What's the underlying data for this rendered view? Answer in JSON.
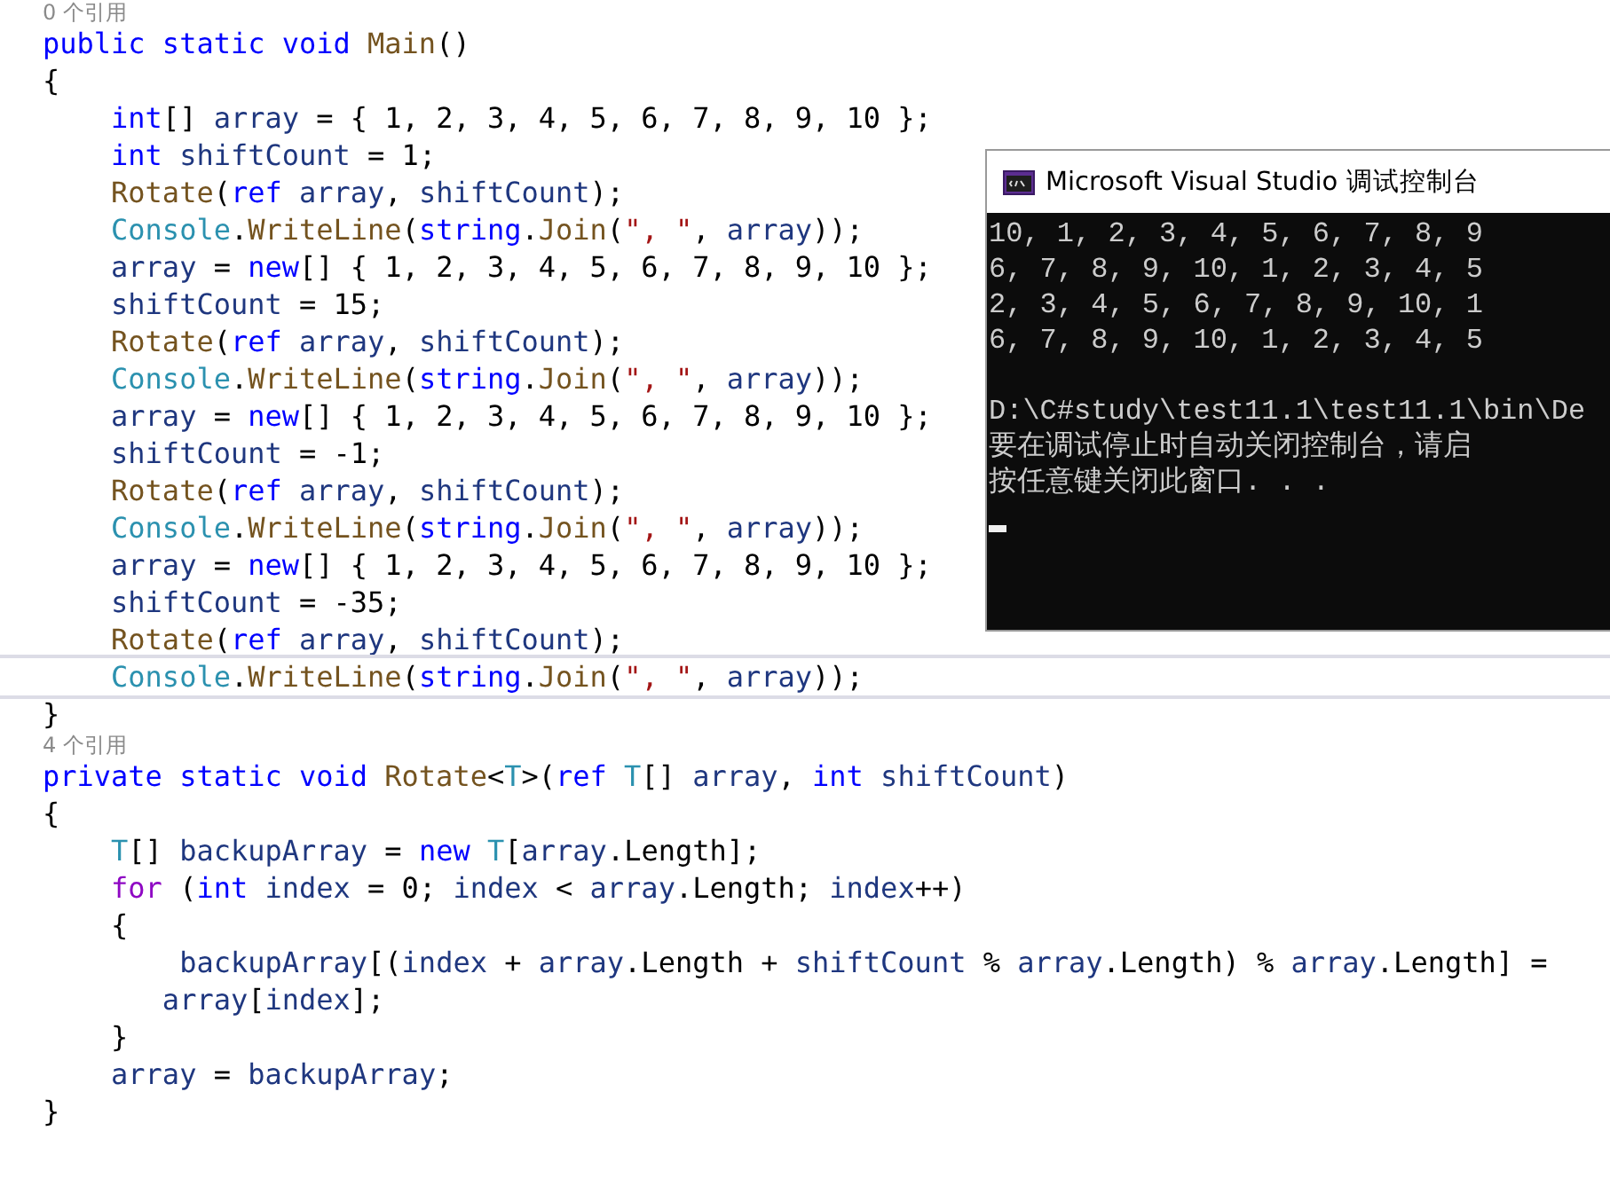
{
  "editor": {
    "lines": [
      {
        "kind": "codelens",
        "text": "0 个引用"
      },
      {
        "kind": "code",
        "current": false,
        "tokens": [
          {
            "text": "public static void ",
            "kind": "kw"
          },
          {
            "text": "Main",
            "kind": "method"
          },
          {
            "text": "()",
            "kind": "plain"
          }
        ]
      },
      {
        "kind": "code",
        "current": false,
        "tokens": [
          {
            "text": "{",
            "kind": "plain"
          }
        ]
      },
      {
        "kind": "code",
        "current": false,
        "tokens": [
          {
            "text": "    int",
            "kind": "kw"
          },
          {
            "text": "[] ",
            "kind": "plain"
          },
          {
            "text": "array",
            "kind": "local"
          },
          {
            "text": " = { 1, 2, 3, 4, 5, 6, 7, 8, 9, 10 };",
            "kind": "plain"
          }
        ]
      },
      {
        "kind": "code",
        "current": false,
        "tokens": [
          {
            "text": "    int",
            "kind": "kw"
          },
          {
            "text": " shiftCount",
            "kind": "local"
          },
          {
            "text": " = 1;",
            "kind": "plain"
          }
        ]
      },
      {
        "kind": "code",
        "current": false,
        "tokens": [
          {
            "text": "    Rotate",
            "kind": "method"
          },
          {
            "text": "(",
            "kind": "plain"
          },
          {
            "text": "ref",
            "kind": "kw"
          },
          {
            "text": " array",
            "kind": "local"
          },
          {
            "text": ", ",
            "kind": "plain"
          },
          {
            "text": "shiftCount",
            "kind": "local"
          },
          {
            "text": ");",
            "kind": "plain"
          }
        ]
      },
      {
        "kind": "code",
        "current": false,
        "tokens": [
          {
            "text": "    Console",
            "kind": "type"
          },
          {
            "text": ".",
            "kind": "plain"
          },
          {
            "text": "WriteLine",
            "kind": "method"
          },
          {
            "text": "(",
            "kind": "plain"
          },
          {
            "text": "string",
            "kind": "kw"
          },
          {
            "text": ".",
            "kind": "plain"
          },
          {
            "text": "Join",
            "kind": "method"
          },
          {
            "text": "(",
            "kind": "plain"
          },
          {
            "text": "\", \"",
            "kind": "str"
          },
          {
            "text": ", ",
            "kind": "plain"
          },
          {
            "text": "array",
            "kind": "local"
          },
          {
            "text": "));",
            "kind": "plain"
          }
        ]
      },
      {
        "kind": "code",
        "current": false,
        "tokens": [
          {
            "text": "    array",
            "kind": "local"
          },
          {
            "text": " = ",
            "kind": "plain"
          },
          {
            "text": "new",
            "kind": "kw"
          },
          {
            "text": "[] { 1, 2, 3, 4, 5, 6, 7, 8, 9, 10 };",
            "kind": "plain"
          }
        ]
      },
      {
        "kind": "code",
        "current": false,
        "tokens": [
          {
            "text": "    shiftCount",
            "kind": "local"
          },
          {
            "text": " = 15;",
            "kind": "plain"
          }
        ]
      },
      {
        "kind": "code",
        "current": false,
        "tokens": [
          {
            "text": "    Rotate",
            "kind": "method"
          },
          {
            "text": "(",
            "kind": "plain"
          },
          {
            "text": "ref",
            "kind": "kw"
          },
          {
            "text": " array",
            "kind": "local"
          },
          {
            "text": ", ",
            "kind": "plain"
          },
          {
            "text": "shiftCount",
            "kind": "local"
          },
          {
            "text": ");",
            "kind": "plain"
          }
        ]
      },
      {
        "kind": "code",
        "current": false,
        "tokens": [
          {
            "text": "    Console",
            "kind": "type"
          },
          {
            "text": ".",
            "kind": "plain"
          },
          {
            "text": "WriteLine",
            "kind": "method"
          },
          {
            "text": "(",
            "kind": "plain"
          },
          {
            "text": "string",
            "kind": "kw"
          },
          {
            "text": ".",
            "kind": "plain"
          },
          {
            "text": "Join",
            "kind": "method"
          },
          {
            "text": "(",
            "kind": "plain"
          },
          {
            "text": "\", \"",
            "kind": "str"
          },
          {
            "text": ", ",
            "kind": "plain"
          },
          {
            "text": "array",
            "kind": "local"
          },
          {
            "text": "));",
            "kind": "plain"
          }
        ]
      },
      {
        "kind": "code",
        "current": false,
        "tokens": [
          {
            "text": "    array",
            "kind": "local"
          },
          {
            "text": " = ",
            "kind": "plain"
          },
          {
            "text": "new",
            "kind": "kw"
          },
          {
            "text": "[] { 1, 2, 3, 4, 5, 6, 7, 8, 9, 10 };",
            "kind": "plain"
          }
        ]
      },
      {
        "kind": "code",
        "current": false,
        "tokens": [
          {
            "text": "    shiftCount",
            "kind": "local"
          },
          {
            "text": " = -1;",
            "kind": "plain"
          }
        ]
      },
      {
        "kind": "code",
        "current": false,
        "tokens": [
          {
            "text": "    Rotate",
            "kind": "method"
          },
          {
            "text": "(",
            "kind": "plain"
          },
          {
            "text": "ref",
            "kind": "kw"
          },
          {
            "text": " array",
            "kind": "local"
          },
          {
            "text": ", ",
            "kind": "plain"
          },
          {
            "text": "shiftCount",
            "kind": "local"
          },
          {
            "text": ");",
            "kind": "plain"
          }
        ]
      },
      {
        "kind": "code",
        "current": false,
        "tokens": [
          {
            "text": "    Console",
            "kind": "type"
          },
          {
            "text": ".",
            "kind": "plain"
          },
          {
            "text": "WriteLine",
            "kind": "method"
          },
          {
            "text": "(",
            "kind": "plain"
          },
          {
            "text": "string",
            "kind": "kw"
          },
          {
            "text": ".",
            "kind": "plain"
          },
          {
            "text": "Join",
            "kind": "method"
          },
          {
            "text": "(",
            "kind": "plain"
          },
          {
            "text": "\", \"",
            "kind": "str"
          },
          {
            "text": ", ",
            "kind": "plain"
          },
          {
            "text": "array",
            "kind": "local"
          },
          {
            "text": "));",
            "kind": "plain"
          }
        ]
      },
      {
        "kind": "code",
        "current": false,
        "tokens": [
          {
            "text": "    array",
            "kind": "local"
          },
          {
            "text": " = ",
            "kind": "plain"
          },
          {
            "text": "new",
            "kind": "kw"
          },
          {
            "text": "[] { 1, 2, 3, 4, 5, 6, 7, 8, 9, 10 };",
            "kind": "plain"
          }
        ]
      },
      {
        "kind": "code",
        "current": false,
        "tokens": [
          {
            "text": "    shiftCount",
            "kind": "local"
          },
          {
            "text": " = -35;",
            "kind": "plain"
          }
        ]
      },
      {
        "kind": "code",
        "current": false,
        "tokens": [
          {
            "text": "    Rotate",
            "kind": "method"
          },
          {
            "text": "(",
            "kind": "plain"
          },
          {
            "text": "ref",
            "kind": "kw"
          },
          {
            "text": " array",
            "kind": "local"
          },
          {
            "text": ", ",
            "kind": "plain"
          },
          {
            "text": "shiftCount",
            "kind": "local"
          },
          {
            "text": ");",
            "kind": "plain"
          }
        ]
      },
      {
        "kind": "code",
        "current": true,
        "tokens": [
          {
            "text": "    Console",
            "kind": "type"
          },
          {
            "text": ".",
            "kind": "plain"
          },
          {
            "text": "WriteLine",
            "kind": "method"
          },
          {
            "text": "(",
            "kind": "plain"
          },
          {
            "text": "string",
            "kind": "kw"
          },
          {
            "text": ".",
            "kind": "plain"
          },
          {
            "text": "Join",
            "kind": "method"
          },
          {
            "text": "(",
            "kind": "plain"
          },
          {
            "text": "\", \"",
            "kind": "str"
          },
          {
            "text": ", ",
            "kind": "plain"
          },
          {
            "text": "array",
            "kind": "local"
          },
          {
            "text": "));",
            "kind": "plain"
          }
        ]
      },
      {
        "kind": "code",
        "current": false,
        "tokens": [
          {
            "text": "}",
            "kind": "plain"
          }
        ]
      },
      {
        "kind": "codelens",
        "text": "4 个引用"
      },
      {
        "kind": "code",
        "current": false,
        "tokens": [
          {
            "text": "private static void ",
            "kind": "kw"
          },
          {
            "text": "Rotate",
            "kind": "method"
          },
          {
            "text": "<",
            "kind": "plain"
          },
          {
            "text": "T",
            "kind": "type"
          },
          {
            "text": ">(",
            "kind": "plain"
          },
          {
            "text": "ref",
            "kind": "kw"
          },
          {
            "text": " T",
            "kind": "type"
          },
          {
            "text": "[] ",
            "kind": "plain"
          },
          {
            "text": "array",
            "kind": "local"
          },
          {
            "text": ", ",
            "kind": "plain"
          },
          {
            "text": "int",
            "kind": "kw"
          },
          {
            "text": " shiftCount",
            "kind": "local"
          },
          {
            "text": ")",
            "kind": "plain"
          }
        ]
      },
      {
        "kind": "code",
        "current": false,
        "tokens": [
          {
            "text": "{",
            "kind": "plain"
          }
        ]
      },
      {
        "kind": "code",
        "current": false,
        "tokens": [
          {
            "text": "    T",
            "kind": "type"
          },
          {
            "text": "[] ",
            "kind": "plain"
          },
          {
            "text": "backupArray",
            "kind": "local"
          },
          {
            "text": " = ",
            "kind": "plain"
          },
          {
            "text": "new",
            "kind": "kw"
          },
          {
            "text": " T",
            "kind": "type"
          },
          {
            "text": "[",
            "kind": "plain"
          },
          {
            "text": "array",
            "kind": "local"
          },
          {
            "text": ".Length];",
            "kind": "plain"
          }
        ]
      },
      {
        "kind": "code",
        "current": false,
        "tokens": [
          {
            "text": "    for",
            "kind": "ctl"
          },
          {
            "text": " (",
            "kind": "plain"
          },
          {
            "text": "int",
            "kind": "kw"
          },
          {
            "text": " index",
            "kind": "local"
          },
          {
            "text": " = 0; ",
            "kind": "plain"
          },
          {
            "text": "index",
            "kind": "local"
          },
          {
            "text": " < ",
            "kind": "plain"
          },
          {
            "text": "array",
            "kind": "local"
          },
          {
            "text": ".Length; ",
            "kind": "plain"
          },
          {
            "text": "index",
            "kind": "local"
          },
          {
            "text": "++)",
            "kind": "plain"
          }
        ]
      },
      {
        "kind": "code",
        "current": false,
        "tokens": [
          {
            "text": "    {",
            "kind": "plain"
          }
        ]
      },
      {
        "kind": "code",
        "current": false,
        "tokens": [
          {
            "text": "        backupArray",
            "kind": "local"
          },
          {
            "text": "[(",
            "kind": "plain"
          },
          {
            "text": "index",
            "kind": "local"
          },
          {
            "text": " + ",
            "kind": "plain"
          },
          {
            "text": "array",
            "kind": "local"
          },
          {
            "text": ".Length + ",
            "kind": "plain"
          },
          {
            "text": "shiftCount",
            "kind": "local"
          },
          {
            "text": " % ",
            "kind": "plain"
          },
          {
            "text": "array",
            "kind": "local"
          },
          {
            "text": ".Length) % ",
            "kind": "plain"
          },
          {
            "text": "array",
            "kind": "local"
          },
          {
            "text": ".Length] =",
            "kind": "plain"
          }
        ]
      },
      {
        "kind": "code",
        "current": false,
        "tokens": [
          {
            "text": "       array",
            "kind": "local"
          },
          {
            "text": "[",
            "kind": "plain"
          },
          {
            "text": "index",
            "kind": "local"
          },
          {
            "text": "];",
            "kind": "plain"
          }
        ]
      },
      {
        "kind": "code",
        "current": false,
        "tokens": [
          {
            "text": "    }",
            "kind": "plain"
          }
        ]
      },
      {
        "kind": "code",
        "current": false,
        "tokens": [
          {
            "text": "    array",
            "kind": "local"
          },
          {
            "text": " = ",
            "kind": "plain"
          },
          {
            "text": "backupArray",
            "kind": "local"
          },
          {
            "text": ";",
            "kind": "plain"
          }
        ]
      },
      {
        "kind": "code",
        "current": false,
        "tokens": [
          {
            "text": "}",
            "kind": "plain"
          }
        ]
      }
    ]
  },
  "console": {
    "title": "Microsoft Visual Studio 调试控制台",
    "output": [
      "10, 1, 2, 3, 4, 5, 6, 7, 8, 9",
      "6, 7, 8, 9, 10, 1, 2, 3, 4, 5",
      "2, 3, 4, 5, 6, 7, 8, 9, 10, 1",
      "6, 7, 8, 9, 10, 1, 2, 3, 4, 5"
    ],
    "messages": [
      "D:\\C#study\\test11.1\\test11.1\\bin\\De",
      "要在调试停止时自动关闭控制台，请启",
      "按任意键关闭此窗口. . ."
    ]
  }
}
